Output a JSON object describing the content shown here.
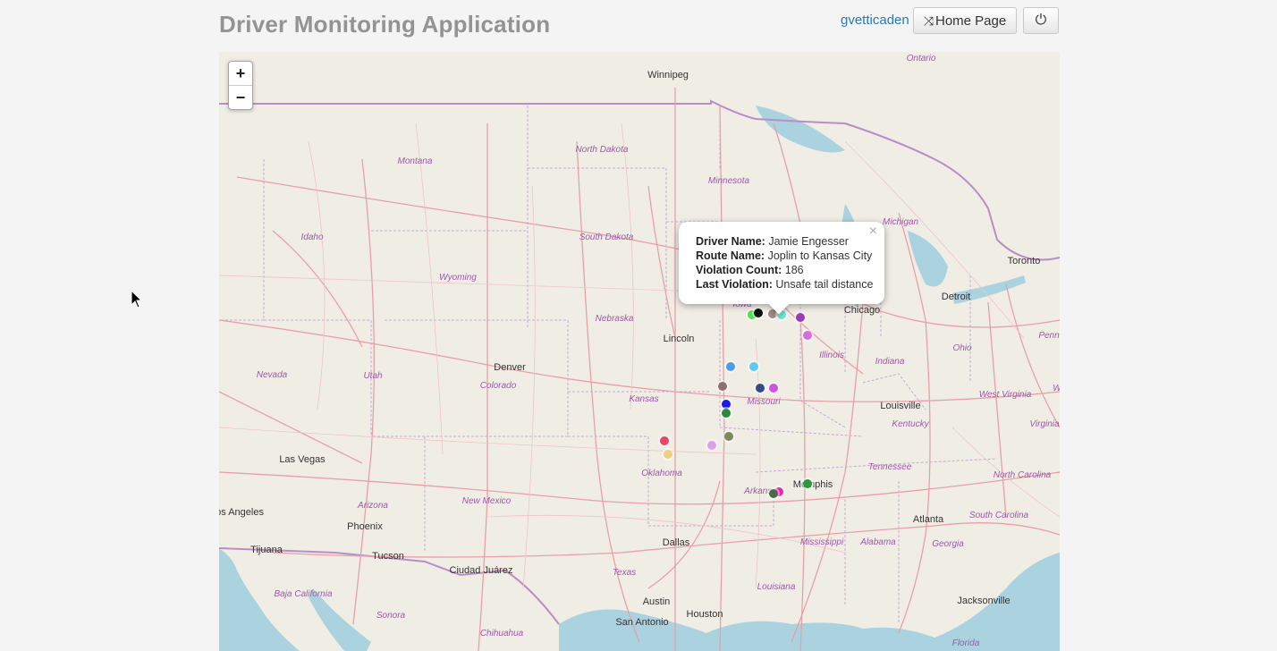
{
  "header": {
    "title": "Driver Monitoring Application",
    "user": "gvetticaden",
    "home_button": "Home Page"
  },
  "map": {
    "zoom_in": "+",
    "zoom_out": "−",
    "region_labels": [
      "Ontario",
      "North Dakota",
      "Montana",
      "Minnesota",
      "South Dakota",
      "Idaho",
      "Wyoming",
      "Michigan",
      "Nebraska",
      "Iowa",
      "Nevada",
      "Utah",
      "Colorado",
      "Kansas",
      "Missouri",
      "Illinois",
      "Indiana",
      "Ohio",
      "Penn",
      "West Virginia",
      "Kentucky",
      "Virginia",
      "Tennessee",
      "North Carolina",
      "Oklahoma",
      "Arkansas",
      "New Mexico",
      "Arizona",
      "Baja California",
      "Sonora",
      "Chihuahua",
      "Texas",
      "Mississippi",
      "Alabama",
      "Georgia",
      "South Carolina",
      "Louisiana",
      "Florida",
      "W"
    ],
    "city_labels": [
      "Winnipeg",
      "Toronto",
      "Detroit",
      "Chicago",
      "Lincoln",
      "Denver",
      "Louisville",
      "Las Vegas",
      "Los Angeles",
      "Memphis",
      "Phoenix",
      "Tijuana",
      "Tucson",
      "Ciudad Juárez",
      "Atlanta",
      "Dallas",
      "Austin",
      "Houston",
      "San Antonio",
      "Jacksonville"
    ],
    "markers": [
      {
        "color": "#55dd55"
      },
      {
        "color": "#111111"
      },
      {
        "color": "#a08888"
      },
      {
        "color": "#6ee6d0"
      },
      {
        "color": "#9a3db5"
      },
      {
        "color": "#d36ee0"
      },
      {
        "color": "#4a9ee8"
      },
      {
        "color": "#5ec8ee"
      },
      {
        "color": "#8e7070"
      },
      {
        "color": "#334c88"
      },
      {
        "color": "#cc55dd"
      },
      {
        "color": "#1a1aee"
      },
      {
        "color": "#2a8a3a"
      },
      {
        "color": "#7a8a5a"
      },
      {
        "color": "#ee4466"
      },
      {
        "color": "#ead080"
      },
      {
        "color": "#dba0e8"
      },
      {
        "color": "#2b9a3b"
      },
      {
        "color": "#ee22bb"
      },
      {
        "color": "#4a6a4a"
      }
    ]
  },
  "popup": {
    "driver_label": "Driver Name:",
    "driver_value": "Jamie Engesser",
    "route_label": "Route Name:",
    "route_value": "Joplin to Kansas City",
    "count_label": "Violation Count:",
    "count_value": "186",
    "violation_label": "Last Violation:",
    "violation_value": "Unsafe tail distance",
    "close": "×"
  },
  "icons": {
    "home": "shuffle-icon",
    "power": "power-icon",
    "cursor": "arrow-cursor-icon"
  }
}
